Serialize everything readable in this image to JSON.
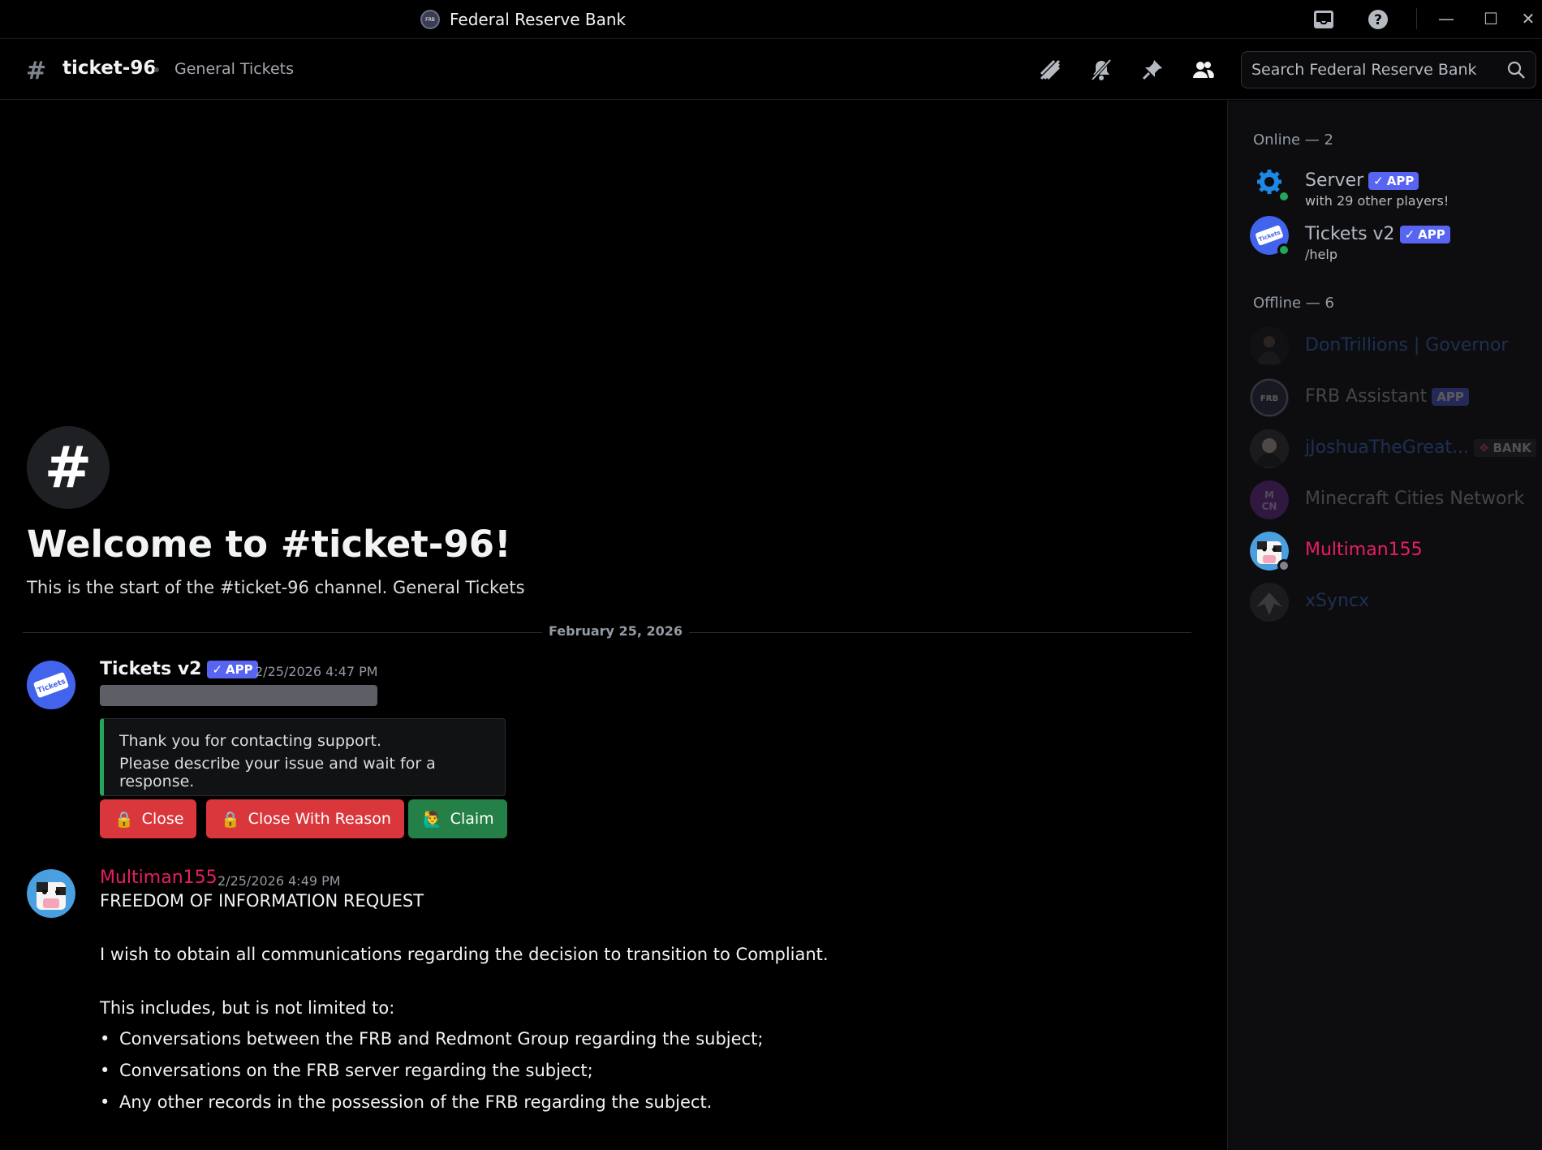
{
  "window": {
    "title": "Federal Reserve Bank",
    "logo_text": "FRB"
  },
  "header": {
    "channel_name": "ticket-96",
    "topic": "General Tickets",
    "search_placeholder": "Search Federal Reserve Bank"
  },
  "welcome": {
    "title": "Welcome to #ticket-96!",
    "subtitle": "This is the start of the #ticket-96 channel. General Tickets"
  },
  "date_divider": "February 25, 2026",
  "messages": [
    {
      "author": "Tickets v2",
      "badge": "APP",
      "timestamp": "2/25/2026 4:47 PM",
      "embed_lines": [
        "Thank you for contacting support.",
        "Please describe your issue and wait for a response."
      ],
      "buttons": [
        {
          "label": "Close",
          "emoji": "🔒"
        },
        {
          "label": "Close With Reason",
          "emoji": "🔒"
        },
        {
          "label": "Claim",
          "emoji": "🙋‍♂️"
        }
      ]
    },
    {
      "author": "Multiman155",
      "timestamp": "2/25/2026 4:49 PM",
      "lines": [
        "FREEDOM OF INFORMATION REQUEST",
        "I wish to obtain all communications regarding the decision to transition to Compliant.",
        "This includes, but is not limited to:"
      ],
      "bullets": [
        "Conversations between the FRB and Redmont Group regarding the subject;",
        "Conversations on the FRB server regarding the subject;",
        "Any other records in the possession of the FRB regarding the subject."
      ]
    }
  ],
  "members": {
    "online_header": "Online — 2",
    "offline_header": "Offline — 6",
    "online": [
      {
        "name": "Server",
        "badge": "APP",
        "activity": "with 29 other players!"
      },
      {
        "name": "Tickets v2",
        "badge": "APP",
        "activity": "/help"
      }
    ],
    "offline": [
      {
        "name": "DonTrillions | Governor",
        "color": "#3f7bd9"
      },
      {
        "name": "FRB Assistant",
        "badge": "APP",
        "color": "#b5bac1",
        "avatar_text": "FRB"
      },
      {
        "name": "jJoshuaTheGreat...",
        "tag": "BANK",
        "color": "#3f7bd9"
      },
      {
        "name": "Minecraft Cities Network",
        "color": "#b5bac1",
        "avatar_text": "MCN"
      },
      {
        "name": "Multiman155",
        "color": "#e91e63"
      },
      {
        "name": "xSyncx",
        "color": "#3f7bd9"
      }
    ]
  },
  "colors": {
    "accent": "#5865f2",
    "online": "#23a55a",
    "danger": "#da373c",
    "success": "#248046",
    "multiman": "#e91e63"
  }
}
